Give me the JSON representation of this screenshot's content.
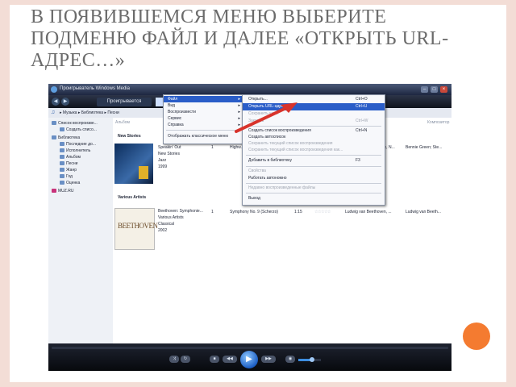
{
  "slide": {
    "title_lines": [
      "В ПОЯВИВШЕМСЯ МЕНЮ ВЫБЕРИТЕ",
      "ПОДМЕНЮ ФАЙЛ И ДАЛЕЕ «ОТКРЫТЬ URL-",
      "АДРЕС…»"
    ],
    "accent_color": "#f47b30",
    "border_color": "#f3ddd6"
  },
  "window": {
    "title": "Проигрыватель Windows Media",
    "min": "–",
    "max": "□",
    "close": "×",
    "back_icon": "◀",
    "fwd_icon": "▶",
    "tab_now_playing": "Проигрывается",
    "breadcrumb": "▸ Музыка ▸ Библиотека ▸ Песни"
  },
  "sidebar": {
    "items": [
      "Список воспроизве...",
      "Создать списо...",
      "Библиотека",
      "Последние до...",
      "Исполнитель",
      "Альбом",
      "Песни",
      "Жанр",
      "Год",
      "Оценка",
      "MUZ.RU"
    ]
  },
  "content": {
    "col_album": "Альбом",
    "col_composer": "Композитор",
    "group1_title": "New Stories",
    "group1_meta": [
      "Speakin' Out",
      "New Stories",
      "Jazz",
      "1999"
    ],
    "group1_row": {
      "num": "1",
      "title": "Highw...",
      "artist": "...ck, N...",
      "composer": "Bennie Green; Ste..."
    },
    "group2_title": "Various Artists",
    "group2_art_text": "BEETHOVEN",
    "group2_meta": [
      "Beethoven: Symphonie...",
      "Various Artists",
      "Classical",
      "2002"
    ],
    "group2_row": {
      "num": "1",
      "title": "Symphony No. 9 (Scherzo)",
      "length": "1:15",
      "rating": "☆☆☆☆☆",
      "artist": "Ludwig van Beethoven, ...",
      "composer": "Ludwig van Beeth..."
    }
  },
  "menu_main": {
    "items": [
      {
        "label": "Файл",
        "submenu": true,
        "selected": true
      },
      {
        "label": "Вид",
        "submenu": true
      },
      {
        "label": "Воспроизвести",
        "submenu": true
      },
      {
        "label": "Сервис",
        "submenu": true
      },
      {
        "label": "Справка",
        "submenu": true
      },
      {
        "label": "Отображать классическое меню",
        "submenu": false
      }
    ],
    "arrow_glyph": "▸"
  },
  "menu_file": {
    "items": [
      {
        "label": "Открыть...",
        "shortcut": "Ctrl+O"
      },
      {
        "label": "Открыть URL-адрес...",
        "shortcut": "Ctrl+U",
        "selected": true
      },
      {
        "label": "Сохранить как...",
        "shortcut": "",
        "disabled": true
      },
      {
        "label": "Закрыть",
        "shortcut": "Ctrl+W",
        "disabled": true
      },
      {
        "label": "Создать список воспроизведения",
        "shortcut": "Ctrl+N"
      },
      {
        "label": "Создать автосписок",
        "shortcut": ""
      },
      {
        "label": "Сохранить текущий список воспроизведения",
        "shortcut": "",
        "disabled": true
      },
      {
        "label": "Сохранить текущий список воспроизведения как...",
        "shortcut": "",
        "disabled": true
      },
      {
        "label": "Добавить в библиотеку",
        "shortcut": "F3"
      },
      {
        "label": "Свойства",
        "shortcut": "",
        "disabled": true
      },
      {
        "label": "Работать автономно",
        "shortcut": ""
      },
      {
        "label": "Недавно воспроизведенные файлы",
        "shortcut": "",
        "disabled": true
      },
      {
        "label": "Выход",
        "shortcut": ""
      }
    ]
  },
  "controls": {
    "shuffle": "⤨",
    "repeat": "↻",
    "stop": "■",
    "prev": "◀◀",
    "play": "▶",
    "next": "▶▶",
    "mute": "◉",
    "volume": 0.6
  }
}
